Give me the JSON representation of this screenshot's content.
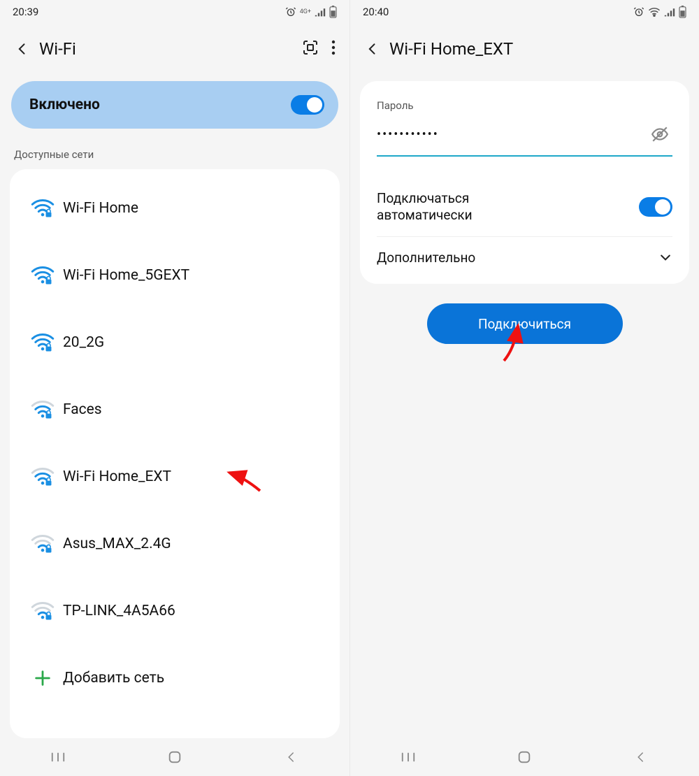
{
  "left": {
    "status": {
      "time": "20:39",
      "net_label": "4G+"
    },
    "header": {
      "title": "Wi-Fi"
    },
    "enabled_label": "Включено",
    "section_label": "Доступные сети",
    "networks": [
      {
        "name": "Wi-Fi Home",
        "strength": "strong",
        "locked": true
      },
      {
        "name": "Wi-Fi Home_5GEXT",
        "strength": "strong",
        "locked": true
      },
      {
        "name": "20_2G",
        "strength": "strong",
        "locked": true
      },
      {
        "name": "Faces",
        "strength": "medium",
        "locked": true
      },
      {
        "name": "Wi-Fi Home_EXT",
        "strength": "medium",
        "locked": true,
        "annotated": true
      },
      {
        "name": "Asus_MAX_2.4G",
        "strength": "weak",
        "locked": true
      },
      {
        "name": "TP-LINK_4A5A66",
        "strength": "weak",
        "locked": true
      }
    ],
    "add_label": "Добавить сеть"
  },
  "right": {
    "status": {
      "time": "20:40"
    },
    "header": {
      "title": "Wi-Fi Home_EXT"
    },
    "password": {
      "label": "Пароль",
      "value": "•••••••••••"
    },
    "auto_connect_label": "Подключаться\nавтоматически",
    "advanced_label": "Дополнительно",
    "connect_label": "Подключиться"
  },
  "colors": {
    "accent": "#0a7de6",
    "pill_bg": "#a8cef2",
    "connect_btn": "#0a74d8",
    "arrow": "#e11"
  }
}
